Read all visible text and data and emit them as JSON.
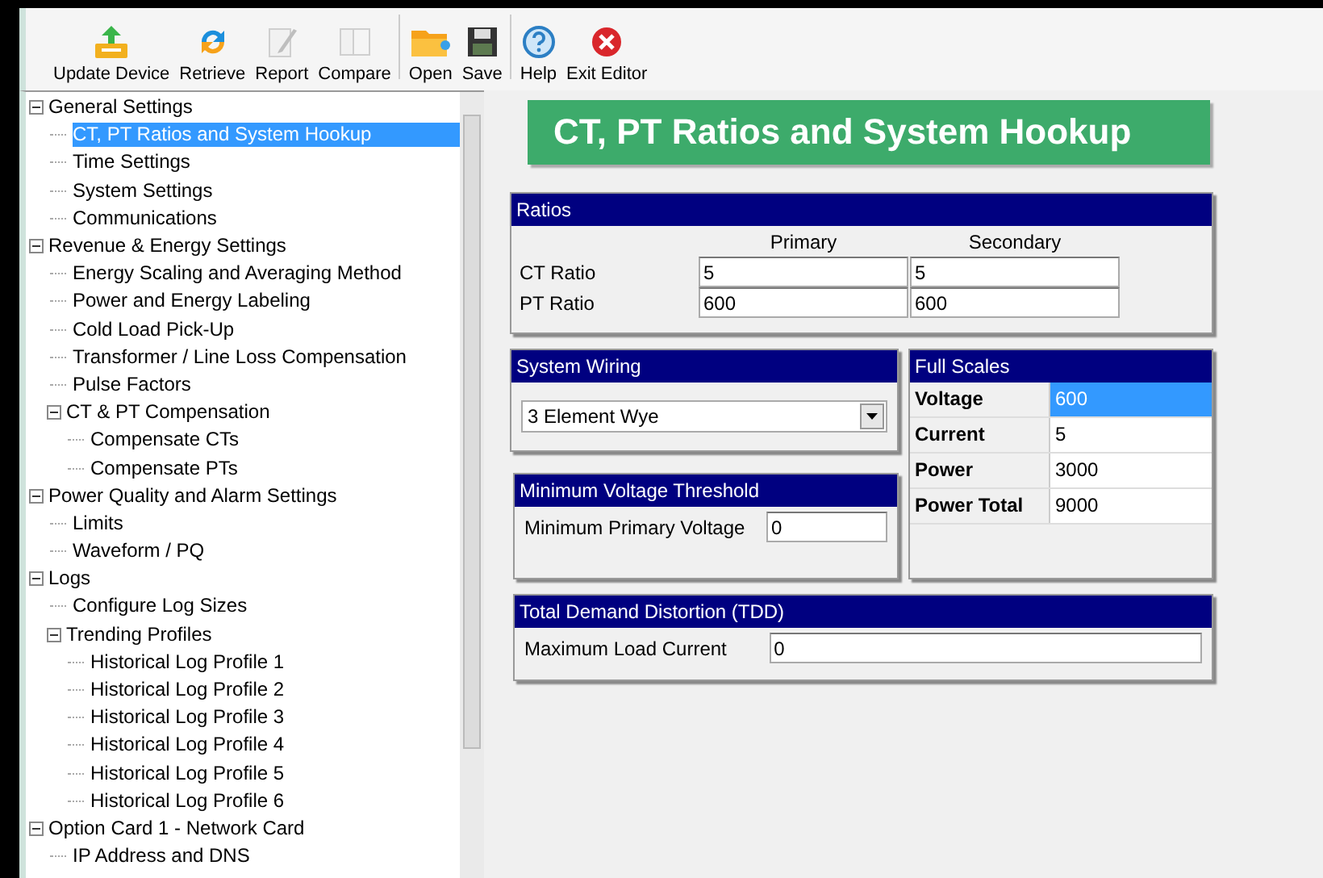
{
  "toolbar": {
    "groups": [
      [
        {
          "label": "Update Device",
          "kind": "upload",
          "disabled": false
        },
        {
          "label": "Retrieve",
          "kind": "refresh",
          "disabled": false
        },
        {
          "label": "Report",
          "kind": "report",
          "disabled": true
        },
        {
          "label": "Compare",
          "kind": "compare",
          "disabled": true
        }
      ],
      [
        {
          "label": "Open",
          "kind": "folder",
          "disabled": false
        },
        {
          "label": "Save",
          "kind": "save",
          "disabled": false
        }
      ],
      [
        {
          "label": "Help",
          "kind": "help",
          "disabled": false
        },
        {
          "label": "Exit Editor",
          "kind": "exit",
          "disabled": false
        }
      ]
    ]
  },
  "tree": [
    {
      "label": "General Settings",
      "expanded": true,
      "selected": false,
      "children": [
        {
          "label": "CT, PT Ratios and System Hookup",
          "selected": true
        },
        {
          "label": "Time Settings",
          "selected": false
        },
        {
          "label": "System Settings",
          "selected": false
        },
        {
          "label": "Communications",
          "selected": false
        }
      ]
    },
    {
      "label": "Revenue & Energy Settings",
      "expanded": true,
      "selected": false,
      "children": [
        {
          "label": "Energy Scaling and Averaging Method",
          "selected": false
        },
        {
          "label": "Power and Energy Labeling",
          "selected": false
        },
        {
          "label": "Cold Load Pick-Up",
          "selected": false
        },
        {
          "label": "Transformer / Line Loss Compensation",
          "selected": false
        },
        {
          "label": "Pulse Factors",
          "selected": false
        },
        {
          "label": "CT & PT Compensation",
          "expanded": true,
          "selected": false,
          "children": [
            {
              "label": "Compensate CTs",
              "selected": false
            },
            {
              "label": "Compensate PTs",
              "selected": false
            }
          ]
        }
      ]
    },
    {
      "label": "Power Quality and Alarm Settings",
      "expanded": true,
      "selected": false,
      "children": [
        {
          "label": "Limits",
          "selected": false
        },
        {
          "label": "Waveform / PQ",
          "selected": false
        }
      ]
    },
    {
      "label": "Logs",
      "expanded": true,
      "selected": false,
      "children": [
        {
          "label": "Configure Log Sizes",
          "selected": false
        },
        {
          "label": "Trending Profiles",
          "expanded": true,
          "selected": false,
          "children": [
            {
              "label": "Historical Log Profile 1",
              "selected": false
            },
            {
              "label": "Historical Log Profile 2",
              "selected": false
            },
            {
              "label": "Historical Log Profile 3",
              "selected": false
            },
            {
              "label": "Historical Log Profile 4",
              "selected": false
            },
            {
              "label": "Historical Log Profile 5",
              "selected": false
            },
            {
              "label": "Historical Log Profile 6",
              "selected": false
            }
          ]
        }
      ]
    },
    {
      "label": "Option Card 1 - Network Card",
      "expanded": true,
      "selected": false,
      "children": [
        {
          "label": "IP Address and DNS",
          "selected": false
        }
      ]
    }
  ],
  "page_title": "CT, PT Ratios and System Hookup",
  "ratios": {
    "title": "Ratios",
    "columns": [
      "Primary",
      "Secondary"
    ],
    "rows": [
      {
        "label": "CT Ratio",
        "primary": "5",
        "secondary": "5"
      },
      {
        "label": "PT Ratio",
        "primary": "600",
        "secondary": "600"
      }
    ]
  },
  "system_wiring": {
    "title": "System Wiring",
    "value": "3 Element Wye"
  },
  "full_scales": {
    "title": "Full Scales",
    "rows": [
      {
        "label": "Voltage",
        "value": "600",
        "selected": true
      },
      {
        "label": "Current",
        "value": "5",
        "selected": false
      },
      {
        "label": "Power",
        "value": "3000",
        "selected": false
      },
      {
        "label": "Power Total",
        "value": "9000",
        "selected": false
      }
    ]
  },
  "minimum_voltage": {
    "title": "Minimum Voltage Threshold",
    "label": "Minimum Primary Voltage",
    "value": "0"
  },
  "tdd": {
    "title": "Total Demand Distortion (TDD)",
    "label": "Maximum Load Current",
    "value": "0"
  }
}
